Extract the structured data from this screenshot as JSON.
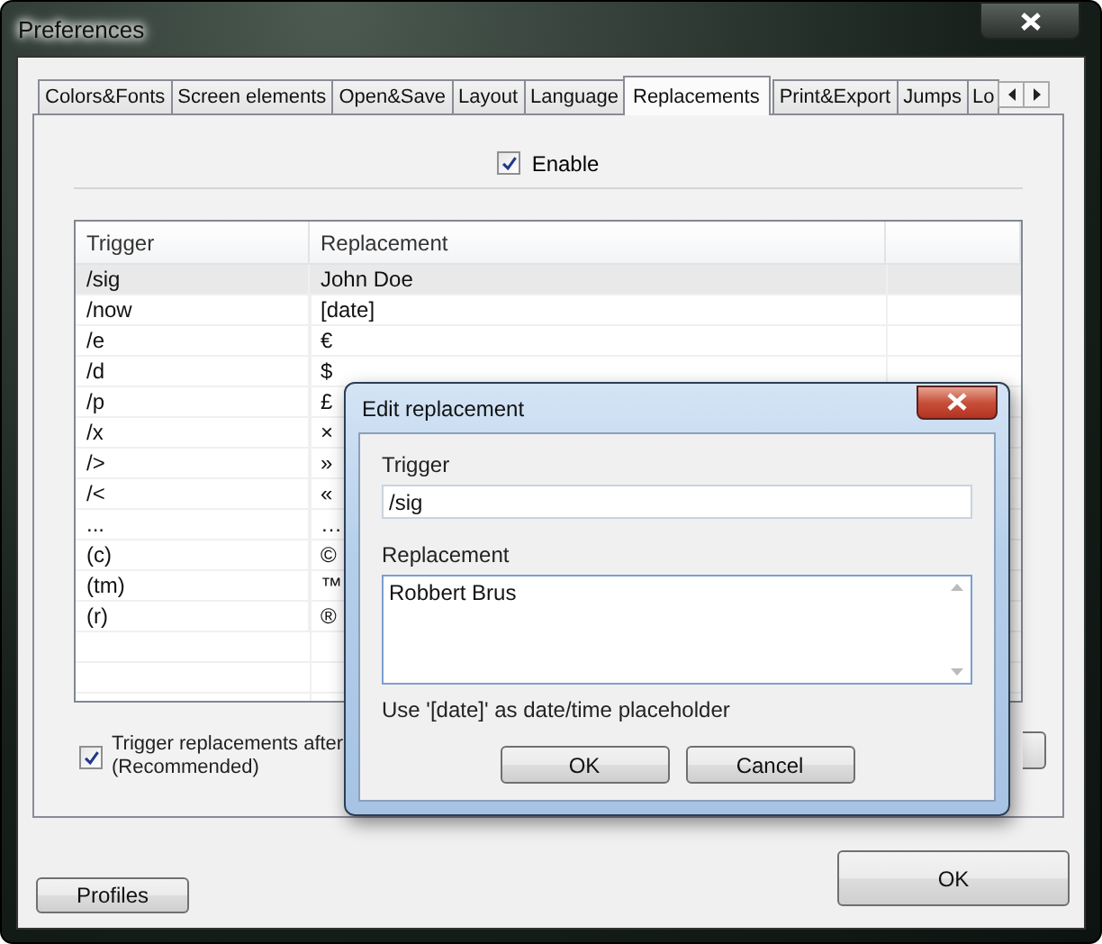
{
  "window": {
    "title": "Preferences"
  },
  "tabs": [
    {
      "label": "Colors&Fonts",
      "selected": false
    },
    {
      "label": "Screen elements",
      "selected": false
    },
    {
      "label": "Open&Save",
      "selected": false
    },
    {
      "label": "Layout",
      "selected": false
    },
    {
      "label": "Language",
      "selected": false
    },
    {
      "label": "Replacements",
      "selected": true
    },
    {
      "label": "Print&Export",
      "selected": false
    },
    {
      "label": "Jumps",
      "selected": false
    },
    {
      "label": "Lo",
      "selected": false
    }
  ],
  "enable": {
    "label": "Enable",
    "checked": true
  },
  "table": {
    "columns": [
      "Trigger",
      "Replacement"
    ],
    "rows": [
      {
        "trigger": "/sig",
        "replacement": "John Doe",
        "selected": true
      },
      {
        "trigger": "/now",
        "replacement": "[date]",
        "selected": false
      },
      {
        "trigger": "/e",
        "replacement": "€",
        "selected": false
      },
      {
        "trigger": "/d",
        "replacement": "$",
        "selected": false
      },
      {
        "trigger": "/p",
        "replacement": "£",
        "selected": false
      },
      {
        "trigger": "/x",
        "replacement": "×",
        "selected": false
      },
      {
        "trigger": "/>",
        "replacement": "»",
        "selected": false
      },
      {
        "trigger": "/<",
        "replacement": "«",
        "selected": false
      },
      {
        "trigger": "...",
        "replacement": "…",
        "selected": false
      },
      {
        "trigger": "(c)",
        "replacement": "©",
        "selected": false
      },
      {
        "trigger": "(tm)",
        "replacement": "™",
        "selected": false
      },
      {
        "trigger": "(r)",
        "replacement": "®",
        "selected": false
      }
    ]
  },
  "trigger_option": {
    "lines": [
      "Trigger replacements after",
      "(Recommended)"
    ],
    "checked": true
  },
  "buttons": {
    "profiles": "Profiles",
    "ok": "OK"
  },
  "dialog": {
    "title": "Edit replacement",
    "trigger_label": "Trigger",
    "trigger_value": "/sig",
    "replacement_label": "Replacement",
    "replacement_value": "Robbert Brus",
    "hint": "Use '[date]' as date/time placeholder",
    "buttons": [
      "OK",
      "Cancel"
    ]
  }
}
